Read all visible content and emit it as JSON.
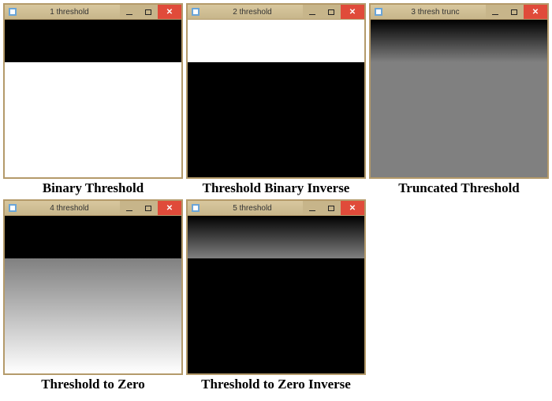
{
  "windows": [
    {
      "title": "1 threshold",
      "caption": "Binary Threshold",
      "contentType": "binary"
    },
    {
      "title": "2 threshold",
      "caption": "Threshold Binary Inverse",
      "contentType": "binary_inv"
    },
    {
      "title": "3 thresh trunc",
      "caption": "Truncated Threshold",
      "contentType": "trunc"
    },
    {
      "title": "4 threshold",
      "caption": "Threshold to Zero",
      "contentType": "tozero"
    },
    {
      "title": "5 threshold",
      "caption": "Threshold to Zero Inverse",
      "contentType": "tozero_inv"
    }
  ],
  "threshold_split_fraction": 0.27,
  "colors": {
    "titlebar_bg": "#c7b58a",
    "titlebar_border": "#b49a6a",
    "close_btn": "#e04b3a"
  }
}
